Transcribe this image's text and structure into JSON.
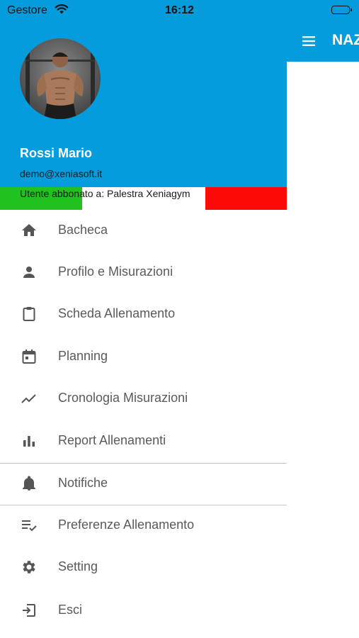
{
  "status_bar": {
    "carrier": "Gestore",
    "time": "16:12"
  },
  "app_bar": {
    "title": "NAZ"
  },
  "drawer": {
    "user": {
      "name": "Rossi Mario",
      "email": "demo@xeniasoft.it",
      "subscription": "Utente abbonato a: Palestra Xeniagym"
    },
    "menu": [
      {
        "label": "Bacheca",
        "icon": "home-icon"
      },
      {
        "label": "Profilo e Misurazioni",
        "icon": "person-icon"
      },
      {
        "label": "Scheda Allenamento",
        "icon": "clipboard-icon"
      },
      {
        "label": "Planning",
        "icon": "calendar-icon"
      },
      {
        "label": "Cronologia Misurazioni",
        "icon": "trending-icon"
      },
      {
        "label": "Report Allenamenti",
        "icon": "bar-chart-icon"
      },
      {
        "label": "Notifiche",
        "icon": "bell-icon"
      },
      {
        "label": "Preferenze Allenamento",
        "icon": "playlist-check-icon"
      },
      {
        "label": "Setting",
        "icon": "gear-icon"
      },
      {
        "label": "Esci",
        "icon": "logout-icon"
      }
    ]
  },
  "colors": {
    "primary": "#049cdc",
    "status_green": "#21c11f",
    "status_red": "#fc0a07"
  }
}
